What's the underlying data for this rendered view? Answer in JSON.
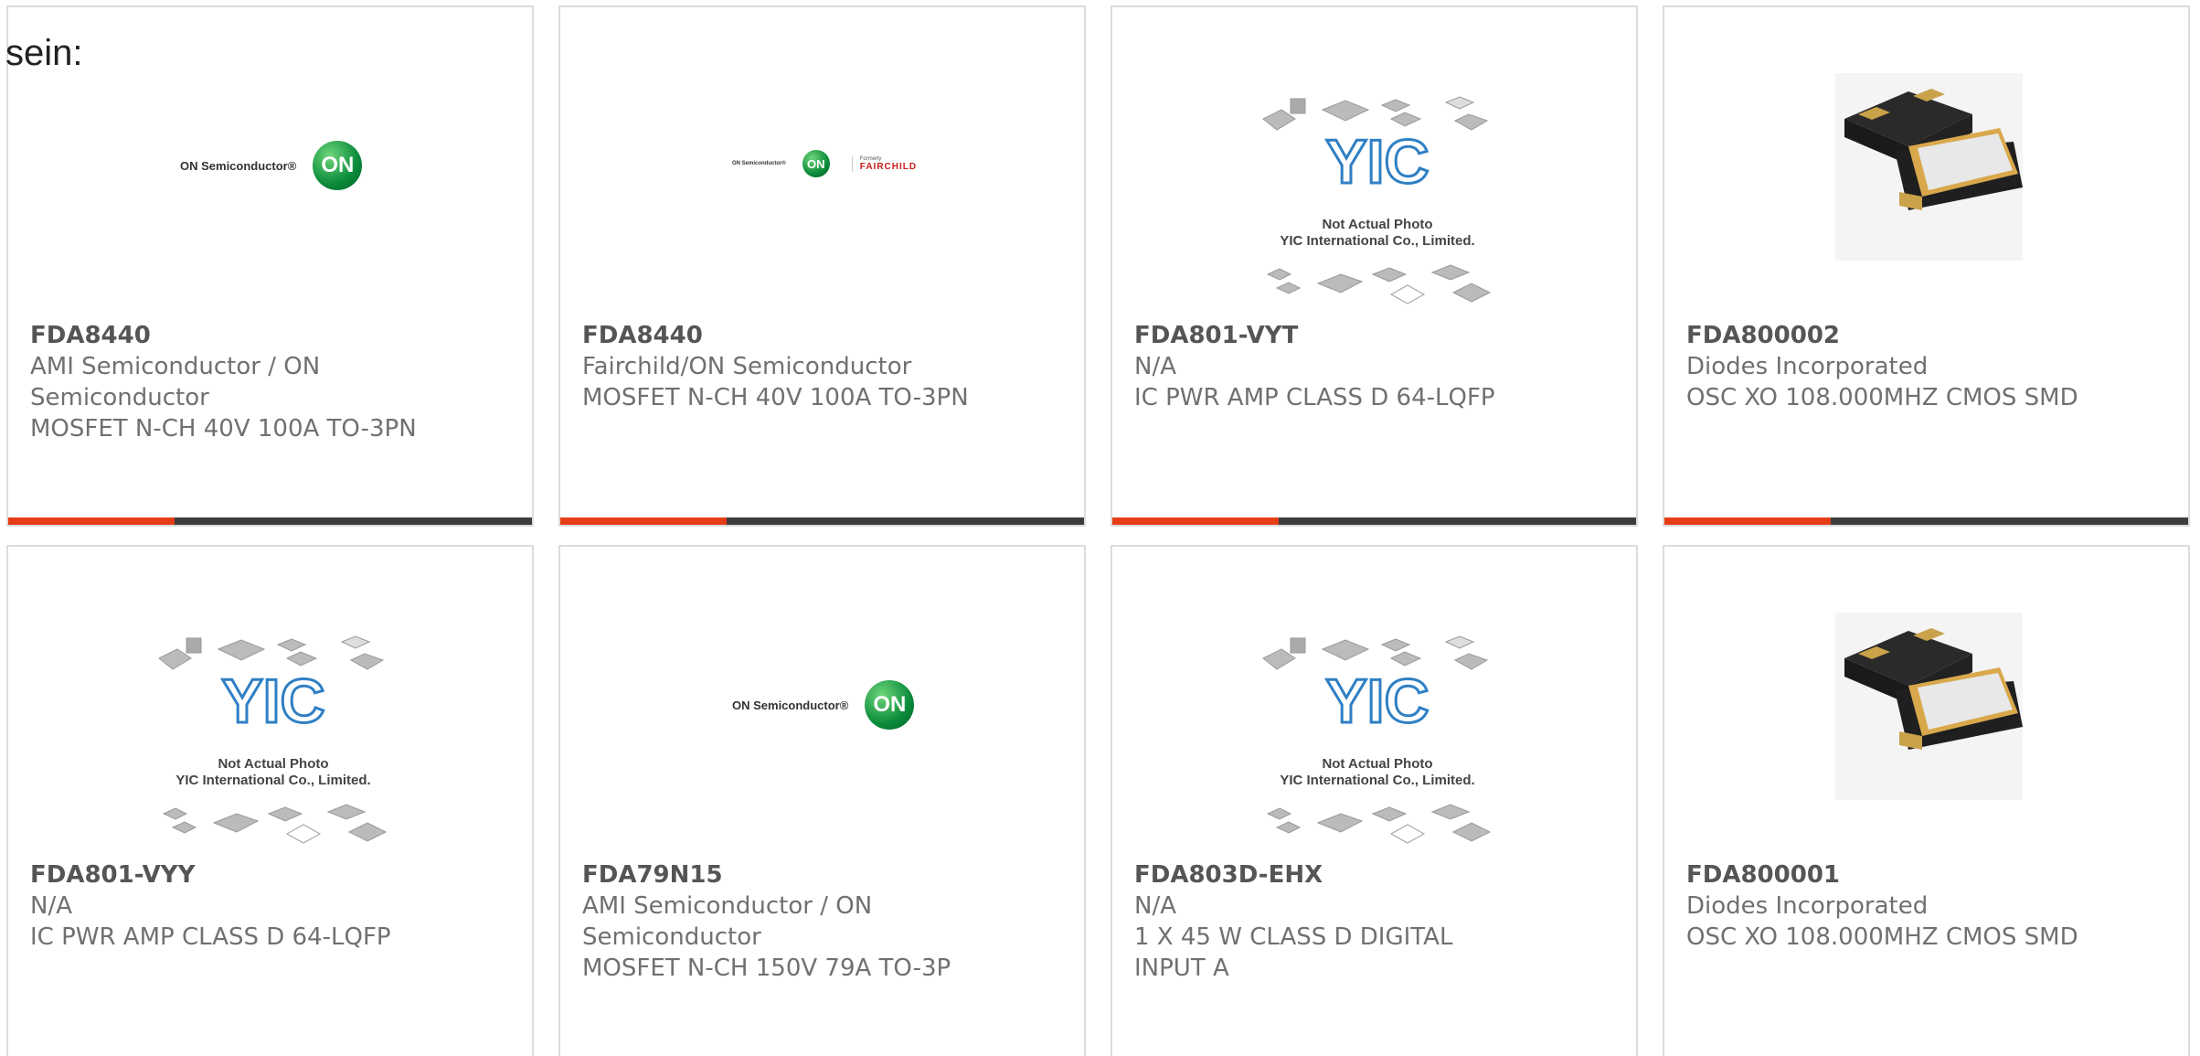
{
  "lead_text": "sein:",
  "logos": {
    "on_wordmark": "ON Semiconductor®",
    "on_symbol": "ON",
    "fairchild_formerly": "Formerly",
    "fairchild_name": "FAIRCHILD",
    "yic_mark": "YIC",
    "yic_line1": "Not Actual Photo",
    "yic_line2": "YIC International Co., Limited."
  },
  "colors": {
    "accent": "#e63c17",
    "bar": "#3c3c3c",
    "border": "#dcdcdc",
    "text": "#707070"
  },
  "products": [
    {
      "image": "on-semiconductor-logo",
      "part_number": "FDA8440",
      "manufacturer_lines": [
        "AMI Semiconductor / ON",
        "Semiconductor"
      ],
      "description": "MOSFET N-CH 40V 100A TO-3PN"
    },
    {
      "image": "on-fairchild-logo",
      "part_number": "FDA8440",
      "manufacturer_lines": [
        "Fairchild/ON Semiconductor"
      ],
      "description": "MOSFET N-CH 40V 100A TO-3PN"
    },
    {
      "image": "yic-not-actual-photo",
      "part_number": "FDA801-VYT",
      "manufacturer_lines": [
        "N/A"
      ],
      "description": "IC PWR AMP CLASS D 64-LQFP"
    },
    {
      "image": "crystal-oscillator-photo",
      "part_number": "FDA800002",
      "manufacturer_lines": [
        "Diodes Incorporated"
      ],
      "description": "OSC XO 108.000MHZ CMOS SMD"
    },
    {
      "image": "yic-not-actual-photo",
      "part_number": "FDA801-VYY",
      "manufacturer_lines": [
        "N/A"
      ],
      "description": "IC PWR AMP CLASS D 64-LQFP"
    },
    {
      "image": "on-semiconductor-logo",
      "part_number": "FDA79N15",
      "manufacturer_lines": [
        "AMI Semiconductor / ON",
        "Semiconductor"
      ],
      "description": "MOSFET N-CH 150V 79A TO-3P"
    },
    {
      "image": "yic-not-actual-photo",
      "part_number": "FDA803D-EHX",
      "manufacturer_lines": [
        "N/A"
      ],
      "description_lines": [
        "1 X 45 W CLASS D DIGITAL",
        "INPUT A"
      ]
    },
    {
      "image": "crystal-oscillator-photo",
      "part_number": "FDA800001",
      "manufacturer_lines": [
        "Diodes Incorporated"
      ],
      "description": "OSC XO 108.000MHZ CMOS SMD"
    }
  ]
}
